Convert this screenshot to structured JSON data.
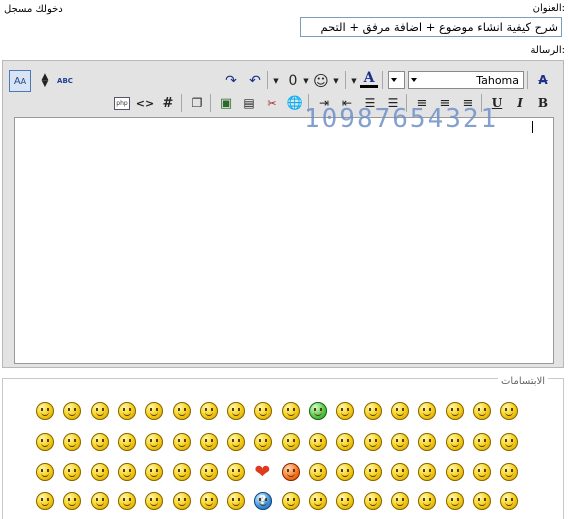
{
  "header": {
    "logged_in_text": "دخولك مسجل",
    "subject_label": "العنوان:",
    "subject_value": "شرح كيفية انشاء موضوع + اضافة مرفق + التحم",
    "message_label": "الرسالة:"
  },
  "toolbar": {
    "font_name": "Tahoma",
    "bold_label": "B",
    "italic_label": "I",
    "underline_label": "U",
    "hash_label": "#",
    "code_label": "<>",
    "php_label": "php",
    "text_color": "#00008b"
  },
  "editor": {
    "overlay_digits": "10987654321"
  },
  "smilies": {
    "legend": "الابتسامات",
    "rows": [
      [
        "cool",
        "grin",
        "smile",
        "wink",
        "sleep",
        "arrow",
        "wink2",
        "tongue",
        "what",
        "gear",
        "green",
        "smile2",
        "circle",
        "back",
        "smile3",
        "crazy",
        "sleepy",
        "roll"
      ],
      [
        "angel",
        "shock",
        "smile4",
        "wave",
        "blink",
        "smile5",
        "sigh",
        "cry",
        "unsure",
        "neutral",
        "blush",
        "smile6",
        "grad",
        "grin2",
        "silly",
        "smile7",
        "wink3",
        "angry"
      ],
      [
        "smile8",
        "tongue2",
        "smile9",
        "love",
        "tongue3",
        "nerd",
        "smile10",
        "kiss",
        "heart",
        "smile11",
        "bored",
        "confused",
        "smile12",
        "shy",
        "wink4",
        "smile13",
        "smile14",
        "mad"
      ],
      [
        "smile15",
        "wink5",
        "laugh",
        "rolleyes",
        "dizzy",
        "ninja",
        "sad",
        "smile16",
        "tease",
        "thinking",
        "cry2",
        "scared",
        "smile17",
        "wink6",
        "sweat",
        "frown",
        "smile18",
        "smile19"
      ]
    ]
  }
}
